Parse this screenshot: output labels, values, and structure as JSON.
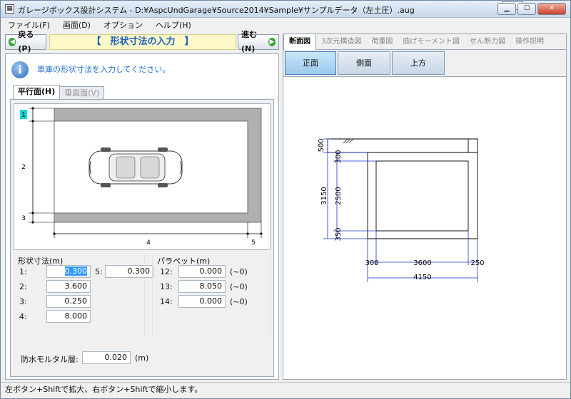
{
  "window": {
    "title": "ガレージボックス設計システム - D:¥AspcUndGarage¥Source2014¥Sample¥サンプルデータ（左土圧）.aug",
    "icon": "grid-icon"
  },
  "menu": [
    "ファイル(F)",
    "画面(D)",
    "オプション",
    "ヘルプ(H)"
  ],
  "nav": {
    "back_label": "戻る(P)",
    "title": "【　形状寸法の入力　】",
    "next_label": "進む(N)"
  },
  "info": {
    "message": "車庫の形状寸法を入力してください。"
  },
  "left_tabs": {
    "horizontal": "平行面(H)",
    "vertical": "垂直面(V)"
  },
  "plan_drawing": {
    "labels": [
      "1",
      "2",
      "3",
      "4",
      "5"
    ]
  },
  "shape_group": {
    "title": "形状寸法(m)",
    "rows": [
      {
        "label": "1:",
        "value": "0.300"
      },
      {
        "label": "2:",
        "value": "3.600"
      },
      {
        "label": "3:",
        "value": "0.250"
      },
      {
        "label": "4:",
        "value": "8.000"
      }
    ],
    "extra": {
      "label": "5:",
      "value": "0.300"
    }
  },
  "parapet_group": {
    "title": "パラペット(m)",
    "rows": [
      {
        "label": "12:",
        "value": "0.000",
        "suffix": "(~0)"
      },
      {
        "label": "13:",
        "value": "8.050",
        "suffix": "(~0)"
      },
      {
        "label": "14:",
        "value": "0.000",
        "suffix": "(~0)"
      }
    ]
  },
  "waterproof": {
    "label": "防水モルタル層:",
    "value": "0.020",
    "unit": "(m)"
  },
  "right_tabs": [
    "断面図",
    "3次元構造図",
    "荷重図",
    "曲げモーメント図",
    "せん断力図",
    "操作説明"
  ],
  "view_buttons": [
    "正面",
    "側面",
    "上方"
  ],
  "section_dims": {
    "left_outer": "3150",
    "left_inner": "2500",
    "top_thickness": "500",
    "top_slab": "300",
    "bottom_slab": "350",
    "bottom_left": "300",
    "bottom_mid": "3600",
    "bottom_right": "250",
    "bottom_total": "4150"
  },
  "status": {
    "text": "左ボタン+Shiftで拡大、右ボタン+Shiftで縮小します。"
  }
}
